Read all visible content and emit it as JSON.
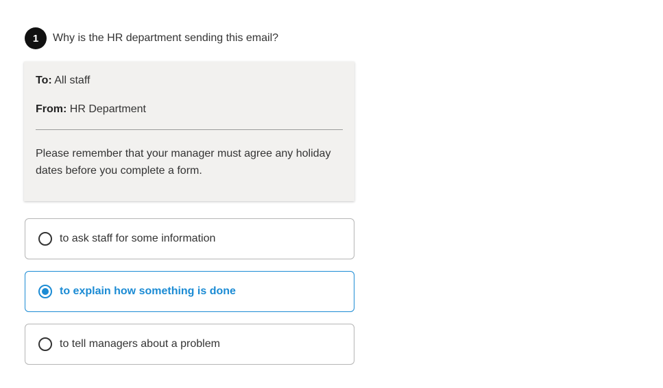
{
  "question": {
    "number": "1",
    "text": "Why is the HR department sending this email?"
  },
  "email": {
    "to_label": "To:",
    "to_value": "All staff",
    "from_label": "From:",
    "from_value": "HR Department",
    "body": "Please remember that your manager must agree any holiday dates before you complete a form."
  },
  "options": [
    {
      "label": "to ask staff for some information",
      "selected": false
    },
    {
      "label": "to explain how something is done",
      "selected": true
    },
    {
      "label": "to tell managers about a problem",
      "selected": false
    }
  ],
  "colors": {
    "accent": "#1b8bd4",
    "card_background": "#f2f1ef",
    "number_badge": "#111111"
  }
}
